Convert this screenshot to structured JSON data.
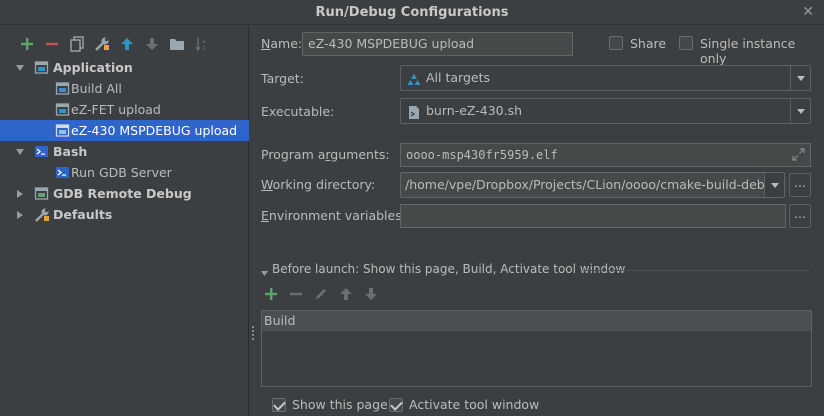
{
  "window": {
    "title": "Run/Debug Configurations",
    "close": "✕"
  },
  "toolbar": {
    "icons": [
      "add-icon",
      "remove-icon",
      "copy-icon",
      "wrench-icon",
      "move-up-icon",
      "move-down-icon",
      "folder-icon",
      "sort-icon"
    ],
    "colors": {
      "add": "#59a869",
      "remove": "#c75450",
      "up": "#3592c4"
    }
  },
  "tree": {
    "application": {
      "label": "Application"
    },
    "build_all": {
      "label": "Build All"
    },
    "ez_fet": {
      "label": "eZ-FET upload"
    },
    "ez_430": {
      "label": "eZ-430 MSPDEBUG upload"
    },
    "bash": {
      "label": "Bash"
    },
    "run_gdb": {
      "label": "Run GDB Server"
    },
    "gdb_remote": {
      "label": "GDB Remote Debug"
    },
    "defaults": {
      "label": "Defaults"
    }
  },
  "form": {
    "name_label_u": "N",
    "name_label_rest": "ame:",
    "name_value": "eZ-430 MSPDEBUG upload",
    "share_label": "Share",
    "single_instance_label": "Single instance only",
    "target_label": "Target:",
    "target_value": "All targets",
    "executable_label": "Executable:",
    "executable_value": "burn-eZ-430.sh",
    "program_args_label_pre": "Program a",
    "program_args_label_u": "r",
    "program_args_label_post": "guments:",
    "program_args_value": "oooo-msp430fr5959.elf",
    "working_dir_label_u": "W",
    "working_dir_label_rest": "orking directory:",
    "working_dir_value": "/home/vpe/Dropbox/Projects/CLion/oooo/cmake-build-debug",
    "env_label_u": "E",
    "env_label_rest": "nvironment variables:",
    "env_value": "",
    "browse": "..."
  },
  "before_launch": {
    "header": "Before launch: Show this page, Build, Activate tool window",
    "items": [
      "Build"
    ],
    "show_this_page": "Show this page",
    "activate_tool_window": "Activate tool window"
  }
}
